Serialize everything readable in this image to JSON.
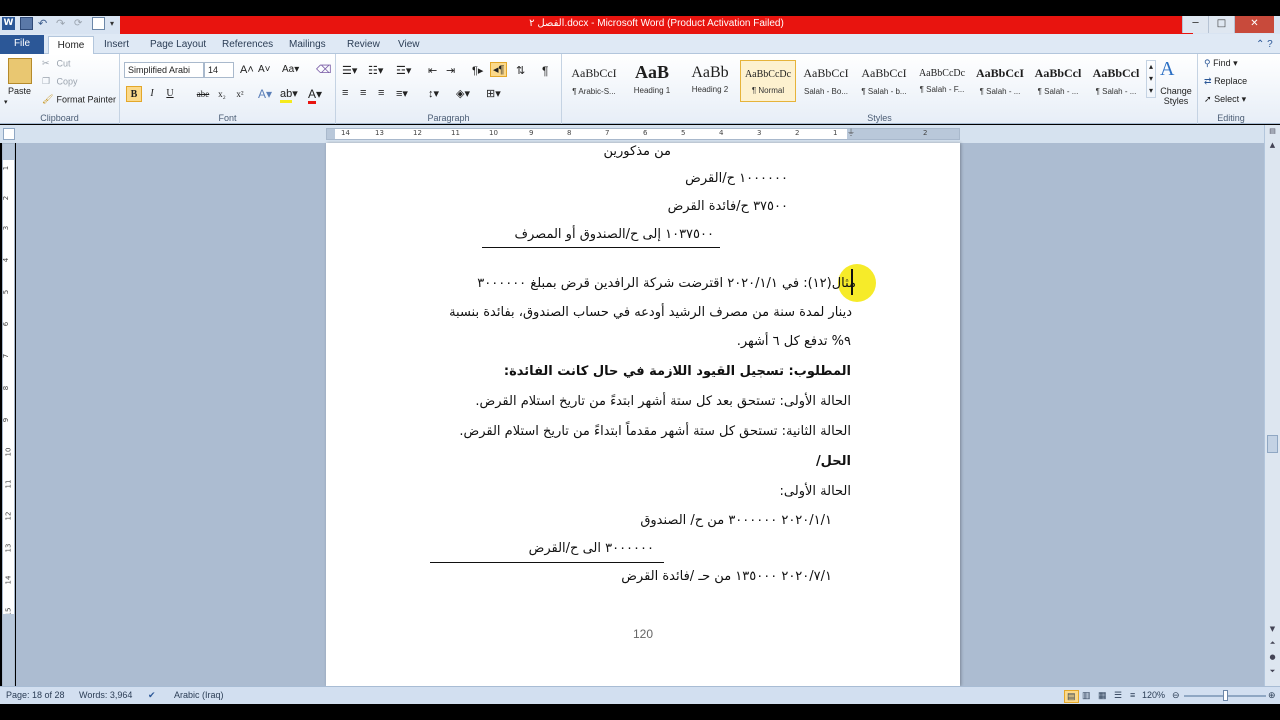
{
  "window": {
    "title": "الفصل ٢.docx - Microsoft Word (Product Activation Failed)",
    "controls": [
      "minimize",
      "maximize",
      "close"
    ]
  },
  "tabs": [
    "File",
    "Home",
    "Insert",
    "Page Layout",
    "References",
    "Mailings",
    "Review",
    "View"
  ],
  "ribbon": {
    "clipboard": {
      "label": "Clipboard",
      "paste": "Paste",
      "cut": "Cut",
      "copy": "Copy",
      "format_painter": "Format Painter"
    },
    "font": {
      "label": "Font",
      "font_name": "Simplified Arabi",
      "font_size": "14",
      "bold": "B",
      "italic": "I",
      "underline": "U",
      "strike": "abe",
      "subscript": "x₂",
      "superscript": "x²"
    },
    "paragraph": {
      "label": "Paragraph"
    },
    "styles": {
      "label": "Styles",
      "items": [
        {
          "preview": "AaBbCcI",
          "name": "¶ Arabic-S..."
        },
        {
          "preview": "AaB",
          "name": "Heading 1"
        },
        {
          "preview": "AaBb",
          "name": "Heading 2"
        },
        {
          "preview": "AaBbCcDc",
          "name": "¶ Normal"
        },
        {
          "preview": "AaBbCcI",
          "name": "Salah - Bo..."
        },
        {
          "preview": "AaBbCcI",
          "name": "¶ Salah - b..."
        },
        {
          "preview": "AaBbCcDc",
          "name": "¶ Salah - F..."
        },
        {
          "preview": "AaBbCcI",
          "name": "¶ Salah - ..."
        },
        {
          "preview": "AaBbCcl",
          "name": "¶ Salah - ..."
        },
        {
          "preview": "AaBbCcl",
          "name": "¶ Salah - ..."
        }
      ],
      "change_styles": "Change Styles"
    },
    "editing": {
      "label": "Editing",
      "find": "Find",
      "replace": "Replace",
      "select": "Select"
    }
  },
  "ruler": {
    "numbers": [
      "14",
      "13",
      "12",
      "11",
      "10",
      "9",
      "8",
      "7",
      "6",
      "5",
      "4",
      "3",
      "2",
      "1",
      "2"
    ],
    "vnumbers": [
      "1",
      "2",
      "3",
      "4",
      "5",
      "6",
      "7",
      "8",
      "9",
      "10",
      "11",
      "12",
      "13",
      "14",
      "15",
      "16"
    ]
  },
  "document": {
    "lines": [
      "من مذكورين",
      "١٠٠٠٠٠٠  ح/القرض",
      "٣٧٥٠٠     ح/فائدة القرض",
      "١٠٣٧٥٠٠  إلى ح/الصندوق أو المصرف",
      "مثال(١٢): في ٢٠٢٠/١/١ اقترضت شركة الرافدين قرض بمبلغ ٣٠٠٠٠٠٠",
      "دينار لمدة سنة من مصرف الرشيد أودعه في حساب الصندوق، بفائدة بنسبة",
      "٩% تدفع كل ٦ أشهر.",
      "المطلوب: تسجيل القيود اللازمة في حال كانت الفائدة:",
      "الحالة الأولى: تستحق بعد كل ستة أشهر ابتدءً من تاريخ استلام القرض.",
      "الحالة الثانية: تستحق كل ستة أشهر مقدماً ابتداءً من تاريخ استلام القرض.",
      "الحل/",
      "الحالة الأولى:",
      "٢٠٢٠/١/١     ٣٠٠٠٠٠٠     من ح/ الصندوق",
      "٣٠٠٠٠٠٠    الى ح/القرض",
      "٢٠٢٠/٧/١     ١٣٥٠٠٠     من حـ /فائدة القرض"
    ],
    "page_number": "120"
  },
  "status": {
    "page": "Page: 18 of 28",
    "words": "Words: 3,964",
    "language": "Arabic (Iraq)",
    "zoom": "120%"
  }
}
